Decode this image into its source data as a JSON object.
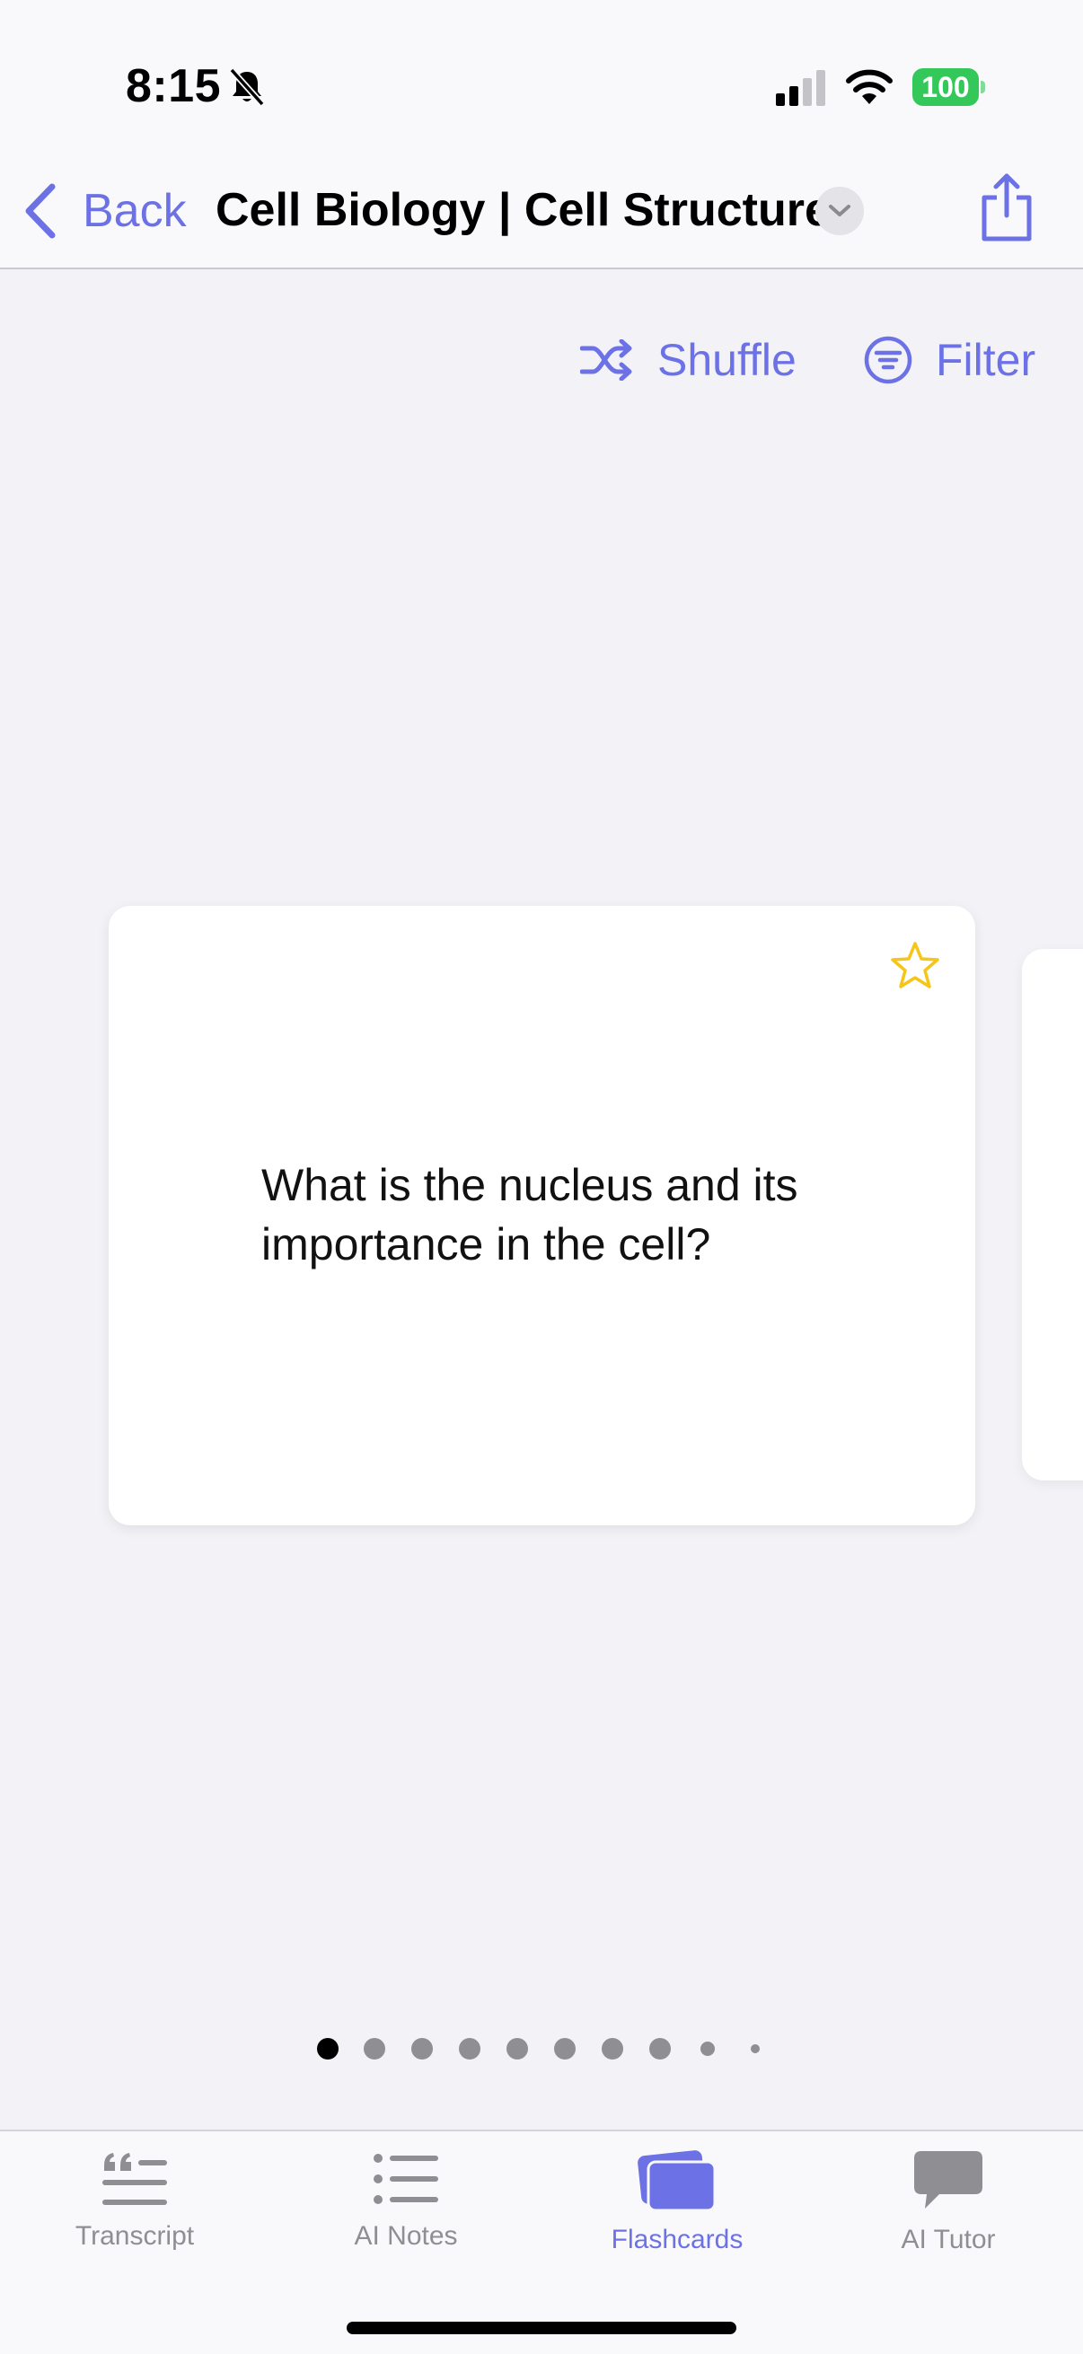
{
  "status_bar": {
    "time": "8:15",
    "battery": "100"
  },
  "nav": {
    "back_label": "Back",
    "title": "Cell Biology | Cell Structure"
  },
  "actions": {
    "shuffle_label": "Shuffle",
    "filter_label": "Filter"
  },
  "card": {
    "question": "What is the nucleus and its importance in the cell?"
  },
  "pager": {
    "current": 1
  },
  "tabs": [
    {
      "label": "Transcript",
      "icon": "quote-lines-icon"
    },
    {
      "label": "AI Notes",
      "icon": "list-icon"
    },
    {
      "label": "Flashcards",
      "icon": "cards-icon"
    },
    {
      "label": "AI Tutor",
      "icon": "chat-bubble-icon"
    }
  ],
  "colors": {
    "accent": "#6c72e6",
    "battery": "#34c759",
    "star": "#f5c518",
    "inactive": "#8e8e93"
  }
}
